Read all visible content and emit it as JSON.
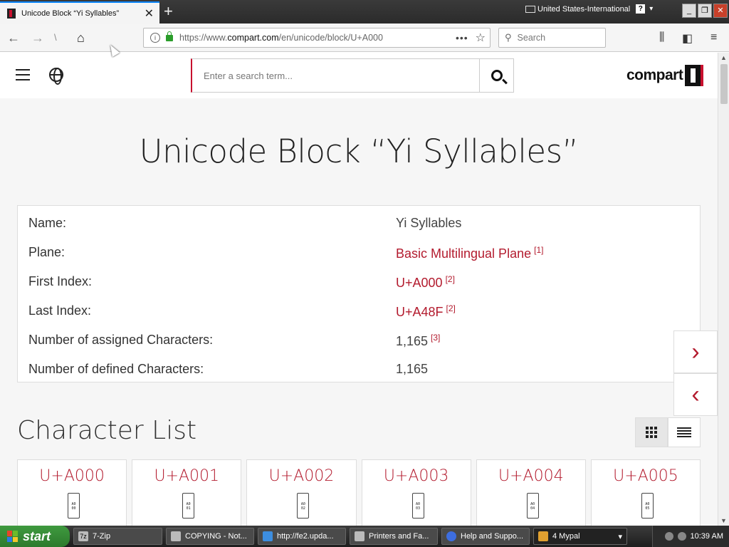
{
  "browser": {
    "tab_title": "Unicode Block “Yi Syllables”",
    "tab_close": "✕",
    "new_tab": "+",
    "language": "United States-International",
    "help": "?",
    "url_prefix": "https://www.",
    "url_domain": "compart.com",
    "url_path": "/en/unicode/block/U+A000",
    "search_placeholder": "Search",
    "page_actions": "•••",
    "bookmark_star": "☆"
  },
  "site": {
    "search_placeholder": "Enter a search term...",
    "logo_text": "compart"
  },
  "page": {
    "title": "Unicode Block “Yi Syllables”",
    "info_rows": [
      {
        "label": "Name:",
        "value": "Yi Syllables",
        "ref": ""
      },
      {
        "label": "Plane:",
        "value": "Basic Multilingual Plane",
        "ref": "[1]"
      },
      {
        "label": "First Index:",
        "value": "U+A000",
        "ref": "[2]"
      },
      {
        "label": "Last Index:",
        "value": "U+A48F",
        "ref": "[2]"
      },
      {
        "label": "Number of assigned Characters:",
        "value": "1,165",
        "ref": "[3]"
      },
      {
        "label": "Number of defined Characters:",
        "value": "1,165",
        "ref": ""
      }
    ],
    "next_arrow": "›",
    "prev_arrow": "‹",
    "character_list_heading": "Character List",
    "characters": [
      {
        "code": "U+A000",
        "glyph_top": "A0",
        "glyph_bottom": "00"
      },
      {
        "code": "U+A001",
        "glyph_top": "A0",
        "glyph_bottom": "01"
      },
      {
        "code": "U+A002",
        "glyph_top": "A0",
        "glyph_bottom": "02"
      },
      {
        "code": "U+A003",
        "glyph_top": "A0",
        "glyph_bottom": "03"
      },
      {
        "code": "U+A004",
        "glyph_top": "A0",
        "glyph_bottom": "04"
      },
      {
        "code": "U+A005",
        "glyph_top": "A0",
        "glyph_bottom": "05"
      }
    ]
  },
  "taskbar": {
    "start": "start",
    "tasks": [
      {
        "label": "7-Zip",
        "icon": "7z"
      },
      {
        "label": "COPYING - Not...",
        "icon": "notepad-icon"
      },
      {
        "label": "http://fe2.upda...",
        "icon": "ie-icon"
      },
      {
        "label": "Printers and Fa...",
        "icon": "printer-icon"
      },
      {
        "label": "Help and Suppo...",
        "icon": "help-icon"
      },
      {
        "label": "4 Mypal",
        "icon": "mypal-icon"
      }
    ],
    "clock": "10:39 AM"
  },
  "colors": {
    "accent": "#b31b2e",
    "tab_highlight": "#0a84ff",
    "taskbar_start": "#3f9a3f"
  }
}
